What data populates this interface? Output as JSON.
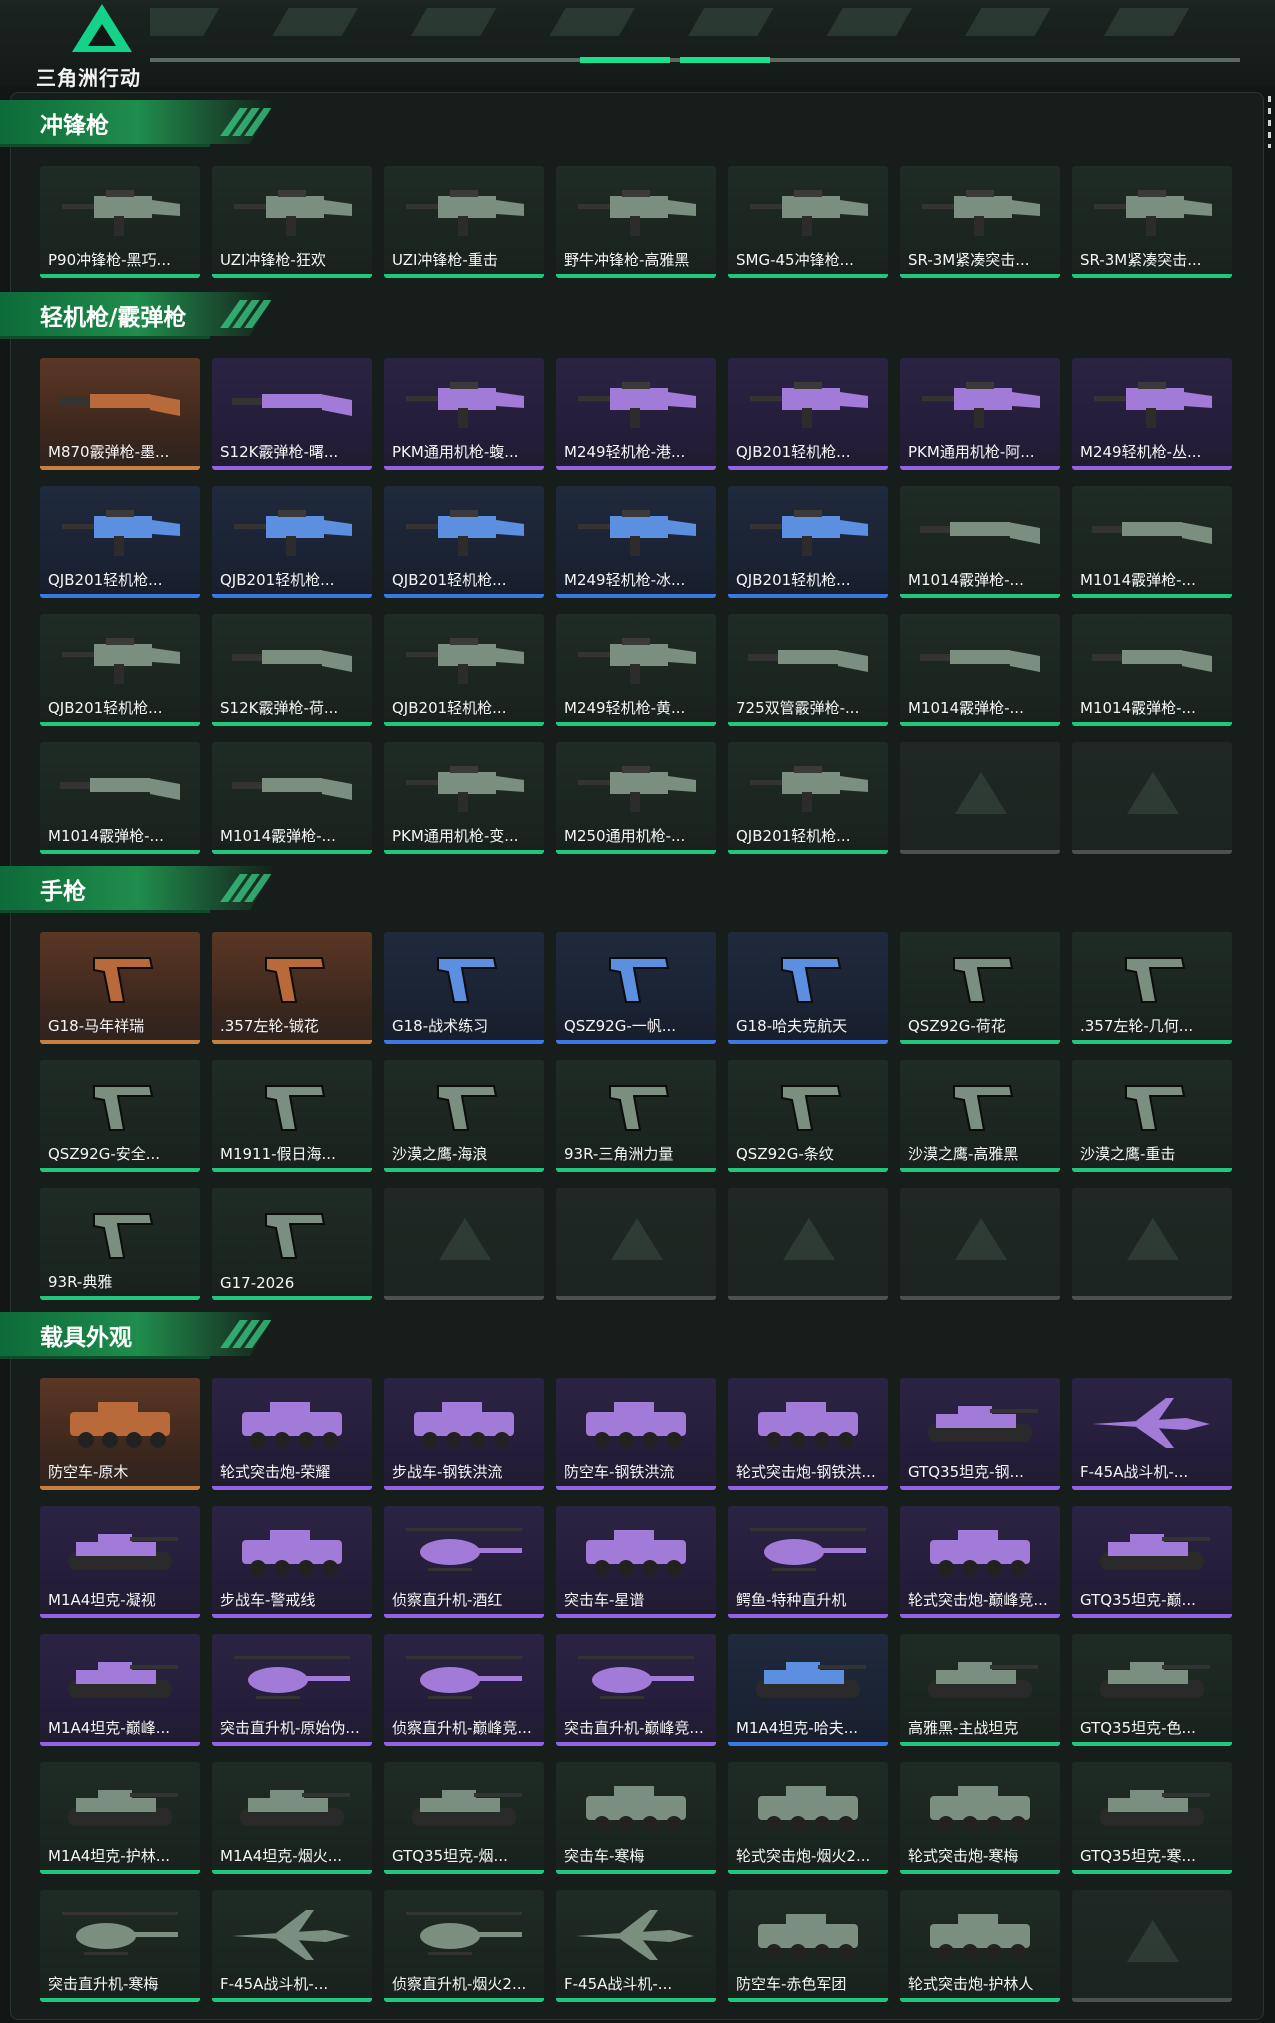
{
  "app": {
    "logo_text": "三角洲行动"
  },
  "colors": {
    "accent": "#19e08a",
    "gold": "#c8803f",
    "purple": "#9064e3",
    "blue": "#3b78e1",
    "green": "#22c77d"
  },
  "sections": [
    {
      "title": "冲锋枪",
      "items": [
        {
          "label": "P90冲锋枪-黑巧...",
          "rarity": "green",
          "icon": "smg-icon"
        },
        {
          "label": "UZI冲锋枪-狂欢",
          "rarity": "green",
          "icon": "smg-icon"
        },
        {
          "label": "UZI冲锋枪-重击",
          "rarity": "green",
          "icon": "smg-icon"
        },
        {
          "label": "野牛冲锋枪-高雅黑",
          "rarity": "green",
          "icon": "smg-icon"
        },
        {
          "label": "SMG-45冲锋枪...",
          "rarity": "green",
          "icon": "smg-icon"
        },
        {
          "label": "SR-3M紧凑突击...",
          "rarity": "green",
          "icon": "smg-icon"
        },
        {
          "label": "SR-3M紧凑突击...",
          "rarity": "green",
          "icon": "smg-icon"
        }
      ]
    },
    {
      "title": "轻机枪/霰弹枪",
      "items": [
        {
          "label": "M870霰弹枪-墨...",
          "rarity": "gold",
          "icon": "shotgun-icon"
        },
        {
          "label": "S12K霰弹枪-曙...",
          "rarity": "purple",
          "icon": "shotgun-icon"
        },
        {
          "label": "PKM通用机枪-蝮...",
          "rarity": "purple",
          "icon": "machine-gun-icon"
        },
        {
          "label": "M249轻机枪-港...",
          "rarity": "purple",
          "icon": "machine-gun-icon"
        },
        {
          "label": "QJB201轻机枪...",
          "rarity": "purple",
          "icon": "machine-gun-icon"
        },
        {
          "label": "PKM通用机枪-阿...",
          "rarity": "purple",
          "icon": "machine-gun-icon"
        },
        {
          "label": "M249轻机枪-丛...",
          "rarity": "purple",
          "icon": "machine-gun-icon"
        },
        {
          "label": "QJB201轻机枪...",
          "rarity": "blue",
          "icon": "machine-gun-icon"
        },
        {
          "label": "QJB201轻机枪...",
          "rarity": "blue",
          "icon": "machine-gun-icon"
        },
        {
          "label": "QJB201轻机枪...",
          "rarity": "blue",
          "icon": "machine-gun-icon"
        },
        {
          "label": "M249轻机枪-冰...",
          "rarity": "blue",
          "icon": "machine-gun-icon"
        },
        {
          "label": "QJB201轻机枪...",
          "rarity": "blue",
          "icon": "machine-gun-icon"
        },
        {
          "label": "M1014霰弹枪-...",
          "rarity": "green",
          "icon": "shotgun-icon"
        },
        {
          "label": "M1014霰弹枪-...",
          "rarity": "green",
          "icon": "shotgun-icon"
        },
        {
          "label": "QJB201轻机枪...",
          "rarity": "green",
          "icon": "machine-gun-icon"
        },
        {
          "label": "S12K霰弹枪-荷...",
          "rarity": "green",
          "icon": "shotgun-icon"
        },
        {
          "label": "QJB201轻机枪...",
          "rarity": "green",
          "icon": "machine-gun-icon"
        },
        {
          "label": "M249轻机枪-黄...",
          "rarity": "green",
          "icon": "machine-gun-icon"
        },
        {
          "label": "725双管霰弹枪-...",
          "rarity": "green",
          "icon": "shotgun-icon"
        },
        {
          "label": "M1014霰弹枪-...",
          "rarity": "green",
          "icon": "shotgun-icon"
        },
        {
          "label": "M1014霰弹枪-...",
          "rarity": "green",
          "icon": "shotgun-icon"
        },
        {
          "label": "M1014霰弹枪-...",
          "rarity": "green",
          "icon": "shotgun-icon"
        },
        {
          "label": "M1014霰弹枪-...",
          "rarity": "green",
          "icon": "shotgun-icon"
        },
        {
          "label": "PKM通用机枪-变...",
          "rarity": "green",
          "icon": "machine-gun-icon"
        },
        {
          "label": "M250通用机枪-...",
          "rarity": "green",
          "icon": "machine-gun-icon"
        },
        {
          "label": "QJB201轻机枪...",
          "rarity": "green",
          "icon": "machine-gun-icon"
        },
        {
          "label": "",
          "rarity": "empty",
          "icon": "empty-slot-icon"
        },
        {
          "label": "",
          "rarity": "empty",
          "icon": "empty-slot-icon"
        }
      ]
    },
    {
      "title": "手枪",
      "items": [
        {
          "label": "G18-马年祥瑞",
          "rarity": "gold",
          "icon": "pistol-icon"
        },
        {
          "label": ".357左轮-铖花",
          "rarity": "gold",
          "icon": "revolver-icon"
        },
        {
          "label": "G18-战术练习",
          "rarity": "blue",
          "icon": "pistol-icon"
        },
        {
          "label": "QSZ92G-一帆...",
          "rarity": "blue",
          "icon": "pistol-icon"
        },
        {
          "label": "G18-哈夫克航天",
          "rarity": "blue",
          "icon": "pistol-icon"
        },
        {
          "label": "QSZ92G-荷花",
          "rarity": "green",
          "icon": "pistol-icon"
        },
        {
          "label": ".357左轮-几何...",
          "rarity": "green",
          "icon": "revolver-icon"
        },
        {
          "label": "QSZ92G-安全...",
          "rarity": "green",
          "icon": "pistol-icon"
        },
        {
          "label": "M1911-假日海...",
          "rarity": "green",
          "icon": "pistol-icon"
        },
        {
          "label": "沙漠之鹰-海浪",
          "rarity": "green",
          "icon": "pistol-icon"
        },
        {
          "label": "93R-三角洲力量",
          "rarity": "green",
          "icon": "pistol-icon"
        },
        {
          "label": "QSZ92G-条纹",
          "rarity": "green",
          "icon": "pistol-icon"
        },
        {
          "label": "沙漠之鹰-高雅黑",
          "rarity": "green",
          "icon": "pistol-icon"
        },
        {
          "label": "沙漠之鹰-重击",
          "rarity": "green",
          "icon": "pistol-icon"
        },
        {
          "label": "93R-典雅",
          "rarity": "green",
          "icon": "pistol-icon"
        },
        {
          "label": "G17-2026",
          "rarity": "green",
          "icon": "pistol-icon"
        },
        {
          "label": "",
          "rarity": "empty",
          "icon": "empty-slot-icon"
        },
        {
          "label": "",
          "rarity": "empty",
          "icon": "empty-slot-icon"
        },
        {
          "label": "",
          "rarity": "empty",
          "icon": "empty-slot-icon"
        },
        {
          "label": "",
          "rarity": "empty",
          "icon": "empty-slot-icon"
        },
        {
          "label": "",
          "rarity": "empty",
          "icon": "empty-slot-icon"
        }
      ]
    },
    {
      "title": "载具外观",
      "items": [
        {
          "label": "防空车-原木",
          "rarity": "gold",
          "icon": "vehicle-icon"
        },
        {
          "label": "轮式突击炮-荣耀",
          "rarity": "purple",
          "icon": "vehicle-icon"
        },
        {
          "label": "步战车-钢铁洪流",
          "rarity": "purple",
          "icon": "vehicle-icon"
        },
        {
          "label": "防空车-钢铁洪流",
          "rarity": "purple",
          "icon": "vehicle-icon"
        },
        {
          "label": "轮式突击炮-钢铁洪...",
          "rarity": "purple",
          "icon": "vehicle-icon"
        },
        {
          "label": "GTQ35坦克-钢...",
          "rarity": "purple",
          "icon": "tank-icon"
        },
        {
          "label": "F-45A战斗机-...",
          "rarity": "purple",
          "icon": "jet-icon"
        },
        {
          "label": "M1A4坦克-凝视",
          "rarity": "purple",
          "icon": "tank-icon"
        },
        {
          "label": "步战车-警戒线",
          "rarity": "purple",
          "icon": "vehicle-icon"
        },
        {
          "label": "侦察直升机-酒红",
          "rarity": "purple",
          "icon": "helicopter-icon"
        },
        {
          "label": "突击车-星谱",
          "rarity": "purple",
          "icon": "vehicle-icon"
        },
        {
          "label": "鳄鱼-特种直升机",
          "rarity": "purple",
          "icon": "helicopter-icon"
        },
        {
          "label": "轮式突击炮-巅峰竞...",
          "rarity": "purple",
          "icon": "vehicle-icon"
        },
        {
          "label": "GTQ35坦克-巅...",
          "rarity": "purple",
          "icon": "tank-icon"
        },
        {
          "label": "M1A4坦克-巅峰...",
          "rarity": "purple",
          "icon": "tank-icon"
        },
        {
          "label": "突击直升机-原始伪...",
          "rarity": "purple",
          "icon": "helicopter-icon"
        },
        {
          "label": "侦察直升机-巅峰竞...",
          "rarity": "purple",
          "icon": "helicopter-icon"
        },
        {
          "label": "突击直升机-巅峰竞...",
          "rarity": "purple",
          "icon": "helicopter-icon"
        },
        {
          "label": "M1A4坦克-哈夫...",
          "rarity": "blue",
          "icon": "tank-icon"
        },
        {
          "label": "高雅黑-主战坦克",
          "rarity": "green",
          "icon": "tank-icon"
        },
        {
          "label": "GTQ35坦克-色...",
          "rarity": "green",
          "icon": "tank-icon"
        },
        {
          "label": "M1A4坦克-护林...",
          "rarity": "green",
          "icon": "tank-icon"
        },
        {
          "label": "M1A4坦克-烟火...",
          "rarity": "green",
          "icon": "tank-icon"
        },
        {
          "label": "GTQ35坦克-烟...",
          "rarity": "green",
          "icon": "tank-icon"
        },
        {
          "label": "突击车-寒梅",
          "rarity": "green",
          "icon": "vehicle-icon"
        },
        {
          "label": "轮式突击炮-烟火2...",
          "rarity": "green",
          "icon": "vehicle-icon"
        },
        {
          "label": "轮式突击炮-寒梅",
          "rarity": "green",
          "icon": "vehicle-icon"
        },
        {
          "label": "GTQ35坦克-寒...",
          "rarity": "green",
          "icon": "tank-icon"
        },
        {
          "label": "突击直升机-寒梅",
          "rarity": "green",
          "icon": "helicopter-icon"
        },
        {
          "label": "F-45A战斗机-...",
          "rarity": "green",
          "icon": "jet-icon"
        },
        {
          "label": "侦察直升机-烟火2...",
          "rarity": "green",
          "icon": "helicopter-icon"
        },
        {
          "label": "F-45A战斗机-...",
          "rarity": "green",
          "icon": "jet-icon"
        },
        {
          "label": "防空车-赤色军团",
          "rarity": "green",
          "icon": "vehicle-icon"
        },
        {
          "label": "轮式突击炮-护林人",
          "rarity": "green",
          "icon": "vehicle-icon"
        },
        {
          "label": "",
          "rarity": "empty",
          "icon": "empty-slot-icon"
        }
      ]
    }
  ]
}
